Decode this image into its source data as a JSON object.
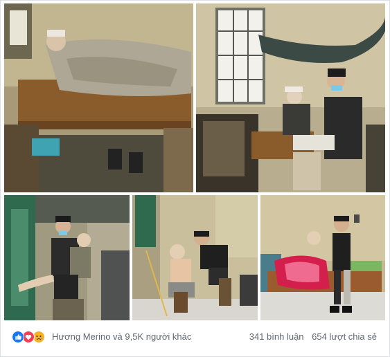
{
  "post": {
    "photos": [
      {
        "id": "photo-1",
        "subject": "elderly-man-in-bed"
      },
      {
        "id": "photo-2",
        "subject": "young-man-sitting-with-elderly-man"
      },
      {
        "id": "photo-3",
        "subject": "young-man-carrying-elderly-man"
      },
      {
        "id": "photo-4",
        "subject": "young-man-washing-elderly-man"
      },
      {
        "id": "photo-5",
        "subject": "young-man-and-elderly-man-on-bed"
      }
    ]
  },
  "footer": {
    "reaction_icons": [
      "like-icon",
      "love-icon",
      "sad-icon"
    ],
    "reactors_text": "Hương Merino và 9,5K người khác",
    "comments_text": "341 bình luận",
    "shares_text": "654 lượt chia sẻ"
  },
  "colors": {
    "like": "#1877f2",
    "love": "#f33e58",
    "sad": "#f7b125",
    "meta_text": "#616770",
    "border": "#dddfe2"
  }
}
